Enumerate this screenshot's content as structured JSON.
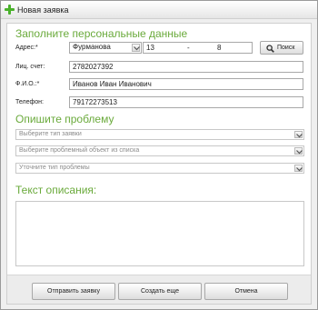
{
  "window": {
    "title": "Новая заявка"
  },
  "personal": {
    "title": "Заполните персональные данные",
    "address_label": "Адрес:*",
    "street": "Фурманова",
    "house": "13",
    "separator": "-",
    "apartment": "8",
    "search_label": "Поиск",
    "account_label": "Лиц. счет:",
    "account": "2782027392",
    "name_label": "Ф.И.О.:*",
    "name": "Иванов Иван Иванович",
    "phone_label": "Телефон:",
    "phone": "79172273513"
  },
  "problem": {
    "title": "Опишите проблему",
    "type_placeholder": "Выберите тип заявки",
    "object_placeholder": "Выберите проблемный объект из списка",
    "subtype_placeholder": "Уточните тип проблемы"
  },
  "description": {
    "title": "Текст описания:",
    "value": ""
  },
  "actions": {
    "send_label": "Отправить заявку",
    "create_more_label": "Создать еще",
    "cancel_label": "Отмена"
  },
  "icons": {
    "title": "plus-icon",
    "search": "magnifier-icon",
    "dropdown": "chevron-down-icon"
  },
  "colors": {
    "accent": "#6aaa3b",
    "plus": "#49b12a"
  }
}
